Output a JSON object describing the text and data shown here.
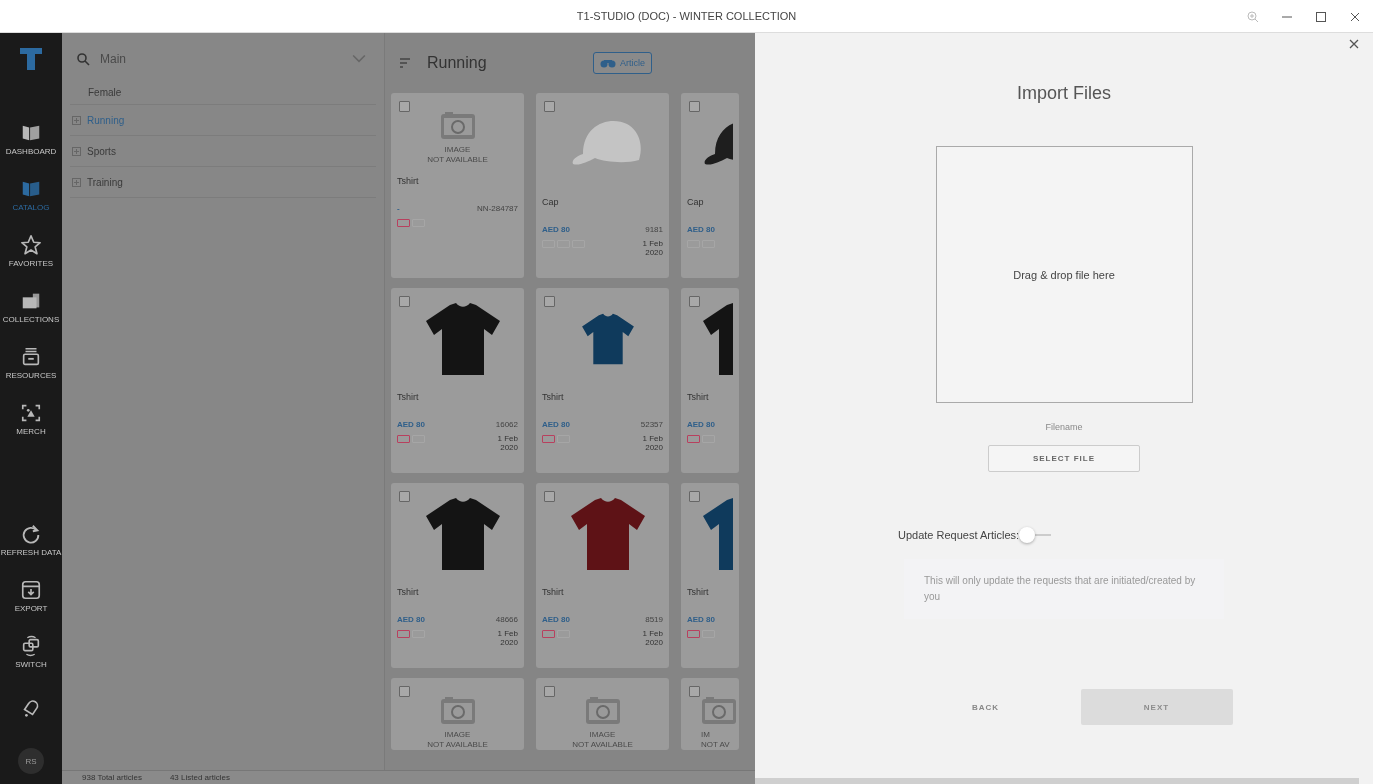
{
  "window": {
    "title": "T1-STUDIO (DOC) - WINTER COLLECTION"
  },
  "nav": {
    "items": [
      {
        "label": "DASHBOARD",
        "selected": false
      },
      {
        "label": "CATALOG",
        "selected": true
      },
      {
        "label": "FAVORITES",
        "selected": false
      },
      {
        "label": "COLLECTIONS",
        "selected": false
      },
      {
        "label": "RESOURCES",
        "selected": false
      },
      {
        "label": "MERCH",
        "selected": false
      }
    ],
    "bottom_items": [
      {
        "label": "REFRESH DATA"
      },
      {
        "label": "EXPORT"
      },
      {
        "label": "SWITCH"
      }
    ],
    "avatar": "RS"
  },
  "side_panel": {
    "search": {
      "value": "Main"
    },
    "group": "Female",
    "tree": [
      {
        "label": "Running",
        "selected": true
      },
      {
        "label": "Sports",
        "selected": false
      },
      {
        "label": "Training",
        "selected": false
      }
    ]
  },
  "catalog": {
    "title": "Running",
    "view_button": "Article",
    "cards": [
      {
        "kind": "placeholder",
        "checked": false,
        "image_note": [
          "IMAGE",
          "NOT AVAILABLE"
        ],
        "name": "Tshirt",
        "price": "-",
        "code": "NN-284787",
        "tags": [
          {
            "color": "#b8405e"
          },
          {
            "color": "#a6a6a6"
          }
        ]
      },
      {
        "kind": "cap",
        "checked": false,
        "color": "#c4c4c4",
        "name": "Cap",
        "price": "AED 80",
        "code": "9181",
        "date": [
          "1 Feb",
          "2020"
        ],
        "tags": [
          {
            "color": "#a6a6a6"
          },
          {
            "color": "#a6a6a6"
          },
          {
            "color": "#a6a6a6"
          }
        ]
      },
      {
        "kind": "cap",
        "checked": false,
        "color": "#1e1e1e",
        "name": "Cap",
        "price": "AED 80",
        "tags": [
          {
            "color": "#a6a6a6"
          },
          {
            "color": "#a6a6a6"
          }
        ]
      },
      {
        "kind": "tshirt",
        "checked": false,
        "color": "#141414",
        "name": "Tshirt",
        "price": "AED 80",
        "code": "16062",
        "date": [
          "1 Feb",
          "2020"
        ],
        "tags": [
          {
            "color": "#b8405e"
          },
          {
            "color": "#a6a6a6"
          }
        ]
      },
      {
        "kind": "polo",
        "checked": false,
        "color": "#0f3a5c",
        "name": "Tshirt",
        "price": "AED 80",
        "code": "52357",
        "date": [
          "1 Feb",
          "2020"
        ],
        "tags": [
          {
            "color": "#b8405e"
          },
          {
            "color": "#a6a6a6"
          }
        ]
      },
      {
        "kind": "tshirt",
        "checked": false,
        "color": "#141414",
        "name": "Tshirt",
        "price": "AED 80",
        "tags": [
          {
            "color": "#b8405e"
          },
          {
            "color": "#a6a6a6"
          }
        ]
      },
      {
        "kind": "tshirt",
        "checked": false,
        "color": "#141414",
        "name": "Tshirt",
        "price": "AED 80",
        "code": "48666",
        "date": [
          "1 Feb",
          "2020"
        ],
        "tags": [
          {
            "color": "#b8405e"
          },
          {
            "color": "#a6a6a6"
          }
        ]
      },
      {
        "kind": "tshirt",
        "checked": false,
        "color": "#5e1216",
        "name": "Tshirt",
        "price": "AED 80",
        "code": "8519",
        "date": [
          "1 Feb",
          "2020"
        ],
        "tags": [
          {
            "color": "#b8405e"
          },
          {
            "color": "#a6a6a6"
          }
        ]
      },
      {
        "kind": "tshirt",
        "checked": false,
        "color": "#0f3a5c",
        "name": "Tshirt",
        "price": "AED 80",
        "tags": [
          {
            "color": "#b8405e"
          },
          {
            "color": "#a6a6a6"
          }
        ]
      },
      {
        "kind": "placeholder",
        "checked": false,
        "image_note": [
          "IMAGE",
          "NOT AVAILABLE"
        ]
      },
      {
        "kind": "placeholder",
        "checked": false,
        "image_note": [
          "IMAGE",
          "NOT AVAILABLE"
        ]
      },
      {
        "kind": "placeholder",
        "checked": false,
        "image_note": [
          "IM",
          "NOT AV"
        ]
      }
    ]
  },
  "status_bar": [
    "938 Total articles",
    "43 Listed articles"
  ],
  "dialog": {
    "title": "Import Files",
    "drop_zone": "Drag & drop file here",
    "filename": {
      "placeholder": "Filename"
    },
    "select_button": "SELECT FILE",
    "toggle": {
      "label": "Update Request Articles:",
      "on": false
    },
    "note": "This will only update the requests that are initiated/created by you",
    "back_button": "BACK",
    "next_button": {
      "label": "NEXT",
      "disabled": true
    }
  }
}
